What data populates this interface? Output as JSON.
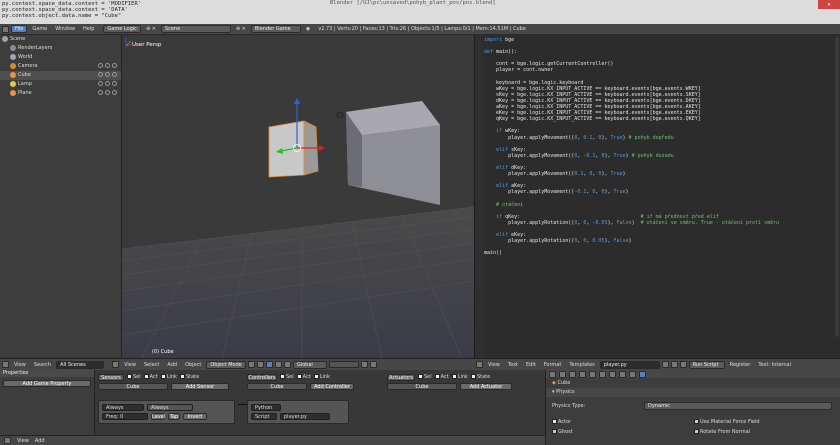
{
  "console": {
    "lines": [
      "py.context.space_data.context = 'MODIFIER'",
      "py.context.space_data.context = 'DATA'",
      "py.context.object.data.name = \"Cube\""
    ],
    "window_title": "Blender  [/UJ\\pc\\unsaved\\pohyb_plant_pos/pos.blend]",
    "close": "✕"
  },
  "info_header": {
    "menus": [
      "File",
      "Game",
      "Window",
      "Help"
    ],
    "screen_layout": "Game Logic",
    "scene": "Scene",
    "engine": "Blender Game",
    "stats": "v2.73 | Verts:20 | Faces:13 | Tris:26 | Objects:1/5 | Lamps:0/1 | Mem:14.51M | Cube"
  },
  "outliner": {
    "items": [
      {
        "label": "Scene",
        "indent": 0,
        "color": "#a0a0a0",
        "vis": false
      },
      {
        "label": "RenderLayers",
        "indent": 1,
        "color": "#8c8c8c",
        "vis": false
      },
      {
        "label": "World",
        "indent": 1,
        "color": "#9ca8b8",
        "vis": false
      },
      {
        "label": "Camera",
        "indent": 1,
        "color": "#d88c30",
        "vis": true
      },
      {
        "label": "Cube",
        "indent": 1,
        "color": "#e89440",
        "vis": true
      },
      {
        "label": "Lamp",
        "indent": 1,
        "color": "#e8c840",
        "vis": true
      },
      {
        "label": "Plane",
        "indent": 1,
        "color": "#e89440",
        "vis": true
      }
    ]
  },
  "viewport": {
    "label": "User Persp",
    "object": "(0) Cube"
  },
  "editor": {
    "lines": [
      [
        [
          "import ",
          "kw"
        ],
        [
          "bge",
          ""
        ]
      ],
      [
        [
          "",
          ""
        ]
      ],
      [
        [
          "def ",
          "kw"
        ],
        [
          "main():",
          ""
        ]
      ],
      [
        [
          "",
          ""
        ]
      ],
      [
        [
          "    cont = bge.logic.getCurrentController()",
          ""
        ]
      ],
      [
        [
          "    player = cont.owner",
          ""
        ]
      ],
      [
        [
          "",
          ""
        ]
      ],
      [
        [
          "    keyboard = bge.logic.keyboard",
          ""
        ]
      ],
      [
        [
          "    wKey = bge.logic.KX_INPUT_ACTIVE == keyboard.events[bge.events.WKEY]",
          ""
        ]
      ],
      [
        [
          "    sKey = bge.logic.KX_INPUT_ACTIVE == keyboard.events[bge.events.SKEY]",
          ""
        ]
      ],
      [
        [
          "    dKey = bge.logic.KX_INPUT_ACTIVE == keyboard.events[bge.events.DKEY]",
          ""
        ]
      ],
      [
        [
          "    aKey = bge.logic.KX_INPUT_ACTIVE == keyboard.events[bge.events.AKEY]",
          ""
        ]
      ],
      [
        [
          "    eKey = bge.logic.KX_INPUT_ACTIVE == keyboard.events[bge.events.EKEY]",
          ""
        ]
      ],
      [
        [
          "    qKey = bge.logic.KX_INPUT_ACTIVE == keyboard.events[bge.events.QKEY]",
          ""
        ]
      ],
      [
        [
          "",
          ""
        ]
      ],
      [
        [
          "    if ",
          "kw"
        ],
        [
          "wKey:",
          ""
        ]
      ],
      [
        [
          "        player.applyMovement((",
          ""
        ],
        [
          "0",
          "nm"
        ],
        [
          ", ",
          ""
        ],
        [
          "0.1",
          "nm"
        ],
        [
          ", ",
          ""
        ],
        [
          "0",
          "nm"
        ],
        [
          "), ",
          ""
        ],
        [
          "True",
          "nm"
        ],
        [
          ") ",
          ""
        ],
        [
          "# pohyb dopředu",
          "cm"
        ]
      ],
      [
        [
          "",
          ""
        ]
      ],
      [
        [
          "    elif ",
          "kw"
        ],
        [
          "sKey:",
          ""
        ]
      ],
      [
        [
          "        player.applyMovement((",
          ""
        ],
        [
          "0",
          "nm"
        ],
        [
          ", ",
          ""
        ],
        [
          "-0.1",
          "nm"
        ],
        [
          ", ",
          ""
        ],
        [
          "0",
          "nm"
        ],
        [
          "), ",
          ""
        ],
        [
          "True",
          "nm"
        ],
        [
          ") ",
          ""
        ],
        [
          "# pohyb dozadu",
          "cm"
        ]
      ],
      [
        [
          "",
          ""
        ]
      ],
      [
        [
          "    elif ",
          "kw"
        ],
        [
          "dKey:",
          ""
        ]
      ],
      [
        [
          "        player.applyMovement((",
          ""
        ],
        [
          "0.1",
          "nm"
        ],
        [
          ", ",
          ""
        ],
        [
          "0",
          "nm"
        ],
        [
          ", ",
          ""
        ],
        [
          "0",
          "nm"
        ],
        [
          "), ",
          ""
        ],
        [
          "True",
          "nm"
        ],
        [
          ")",
          ""
        ]
      ],
      [
        [
          "",
          ""
        ]
      ],
      [
        [
          "    elif ",
          "kw"
        ],
        [
          "aKey:",
          ""
        ]
      ],
      [
        [
          "        player.applyMovement((",
          ""
        ],
        [
          "-0.1",
          "nm"
        ],
        [
          ", ",
          ""
        ],
        [
          "0",
          "nm"
        ],
        [
          ", ",
          ""
        ],
        [
          "0",
          "nm"
        ],
        [
          "), ",
          ""
        ],
        [
          "True",
          "nm"
        ],
        [
          ")",
          ""
        ]
      ],
      [
        [
          "",
          ""
        ]
      ],
      [
        [
          "    # otáčení",
          "cm"
        ]
      ],
      [
        [
          "",
          ""
        ]
      ],
      [
        [
          "    if ",
          "kw"
        ],
        [
          "qKey:",
          ""
        ],
        [
          "                                        # if má přednost před elif",
          "cm"
        ]
      ],
      [
        [
          "        player.applyRotation((",
          ""
        ],
        [
          "0",
          "nm"
        ],
        [
          ", ",
          ""
        ],
        [
          "0",
          "nm"
        ],
        [
          ", ",
          ""
        ],
        [
          "-0.05",
          "nm"
        ],
        [
          "), ",
          ""
        ],
        [
          "False",
          "nm"
        ],
        [
          ")  ",
          ""
        ],
        [
          "# otáčení ve směru, True - otáčení proti směru",
          "cm"
        ]
      ],
      [
        [
          "",
          ""
        ]
      ],
      [
        [
          "    elif ",
          "kw"
        ],
        [
          "eKey:",
          ""
        ]
      ],
      [
        [
          "        player.applyRotation((",
          ""
        ],
        [
          "0",
          "nm"
        ],
        [
          ", ",
          ""
        ],
        [
          "0",
          "nm"
        ],
        [
          ", ",
          ""
        ],
        [
          "0.05",
          "nm"
        ],
        [
          "), ",
          ""
        ],
        [
          "False",
          "nm"
        ],
        [
          ")",
          ""
        ]
      ],
      [
        [
          "",
          ""
        ]
      ],
      [
        [
          "main()",
          ""
        ]
      ]
    ]
  },
  "vp_header": {
    "menus": [
      "View",
      "Search"
    ],
    "all_scenes": "All Scenes",
    "menus2": [
      "View",
      "Select",
      "Add",
      "Object"
    ],
    "mode": "Object Mode",
    "pivot": "Global"
  },
  "ed_header": {
    "menus": [
      "View",
      "Text",
      "Edit",
      "Format",
      "Templates"
    ],
    "file": "player.py",
    "run": "Run Script",
    "register": "Register",
    "internal": "Text: Internal"
  },
  "props": {
    "title": "Properties",
    "add_prop": "Add Game Property"
  },
  "logic": {
    "sensors": {
      "title": "Sensors",
      "opts": [
        "Sel",
        "Act",
        "Link",
        "State"
      ],
      "obj": "Cube",
      "add": "Add Sensor",
      "type": "Always",
      "name": "Always",
      "freq_label": "Freq:",
      "freq": "0",
      "level": "Level",
      "tap": "Tap",
      "invert": "Invert"
    },
    "controllers": {
      "title": "Controllers",
      "opts": [
        "Sel",
        "Act",
        "Link"
      ],
      "obj": "Cube",
      "add": "Add Controller",
      "type": "Python",
      "mode": "Script",
      "script": "player.py"
    },
    "actuators": {
      "title": "Actuators",
      "opts": [
        "Sel",
        "Act",
        "Link",
        "State"
      ],
      "obj": "Cube",
      "add": "Add Actuator"
    }
  },
  "physics": {
    "obj": "Cube",
    "section": "Physics",
    "type_label": "Physics Type:",
    "type_value": "Dynamic",
    "actor": "Actor",
    "ghost": "Ghost",
    "material_force": "Use Material Force Field",
    "rotate_normal": "Rotate From Normal"
  },
  "bottom_bar": {
    "menus": [
      "View",
      "Add"
    ]
  }
}
